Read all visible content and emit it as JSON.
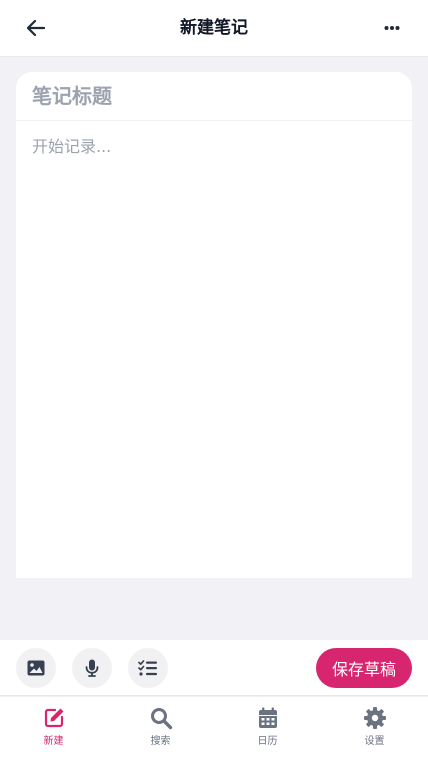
{
  "header": {
    "title": "新建笔记",
    "back_icon": "arrow-left-icon",
    "more_icon": "ellipsis-icon"
  },
  "editor": {
    "title_placeholder": "笔记标题",
    "title_value": "",
    "body_placeholder": "开始记录...",
    "body_value": ""
  },
  "toolbar": {
    "tools": [
      {
        "icon": "image-icon"
      },
      {
        "icon": "microphone-icon"
      },
      {
        "icon": "checklist-icon"
      }
    ],
    "save_label": "保存草稿"
  },
  "nav": {
    "items": [
      {
        "label": "新建",
        "icon": "edit-icon",
        "active": true
      },
      {
        "label": "搜索",
        "icon": "search-icon",
        "active": false
      },
      {
        "label": "日历",
        "icon": "calendar-icon",
        "active": false
      },
      {
        "label": "设置",
        "icon": "gear-icon",
        "active": false
      }
    ]
  },
  "colors": {
    "accent": "#d8256f",
    "icon_dark": "#374151",
    "icon_muted": "#6b7280",
    "background": "#f1f1f6"
  }
}
